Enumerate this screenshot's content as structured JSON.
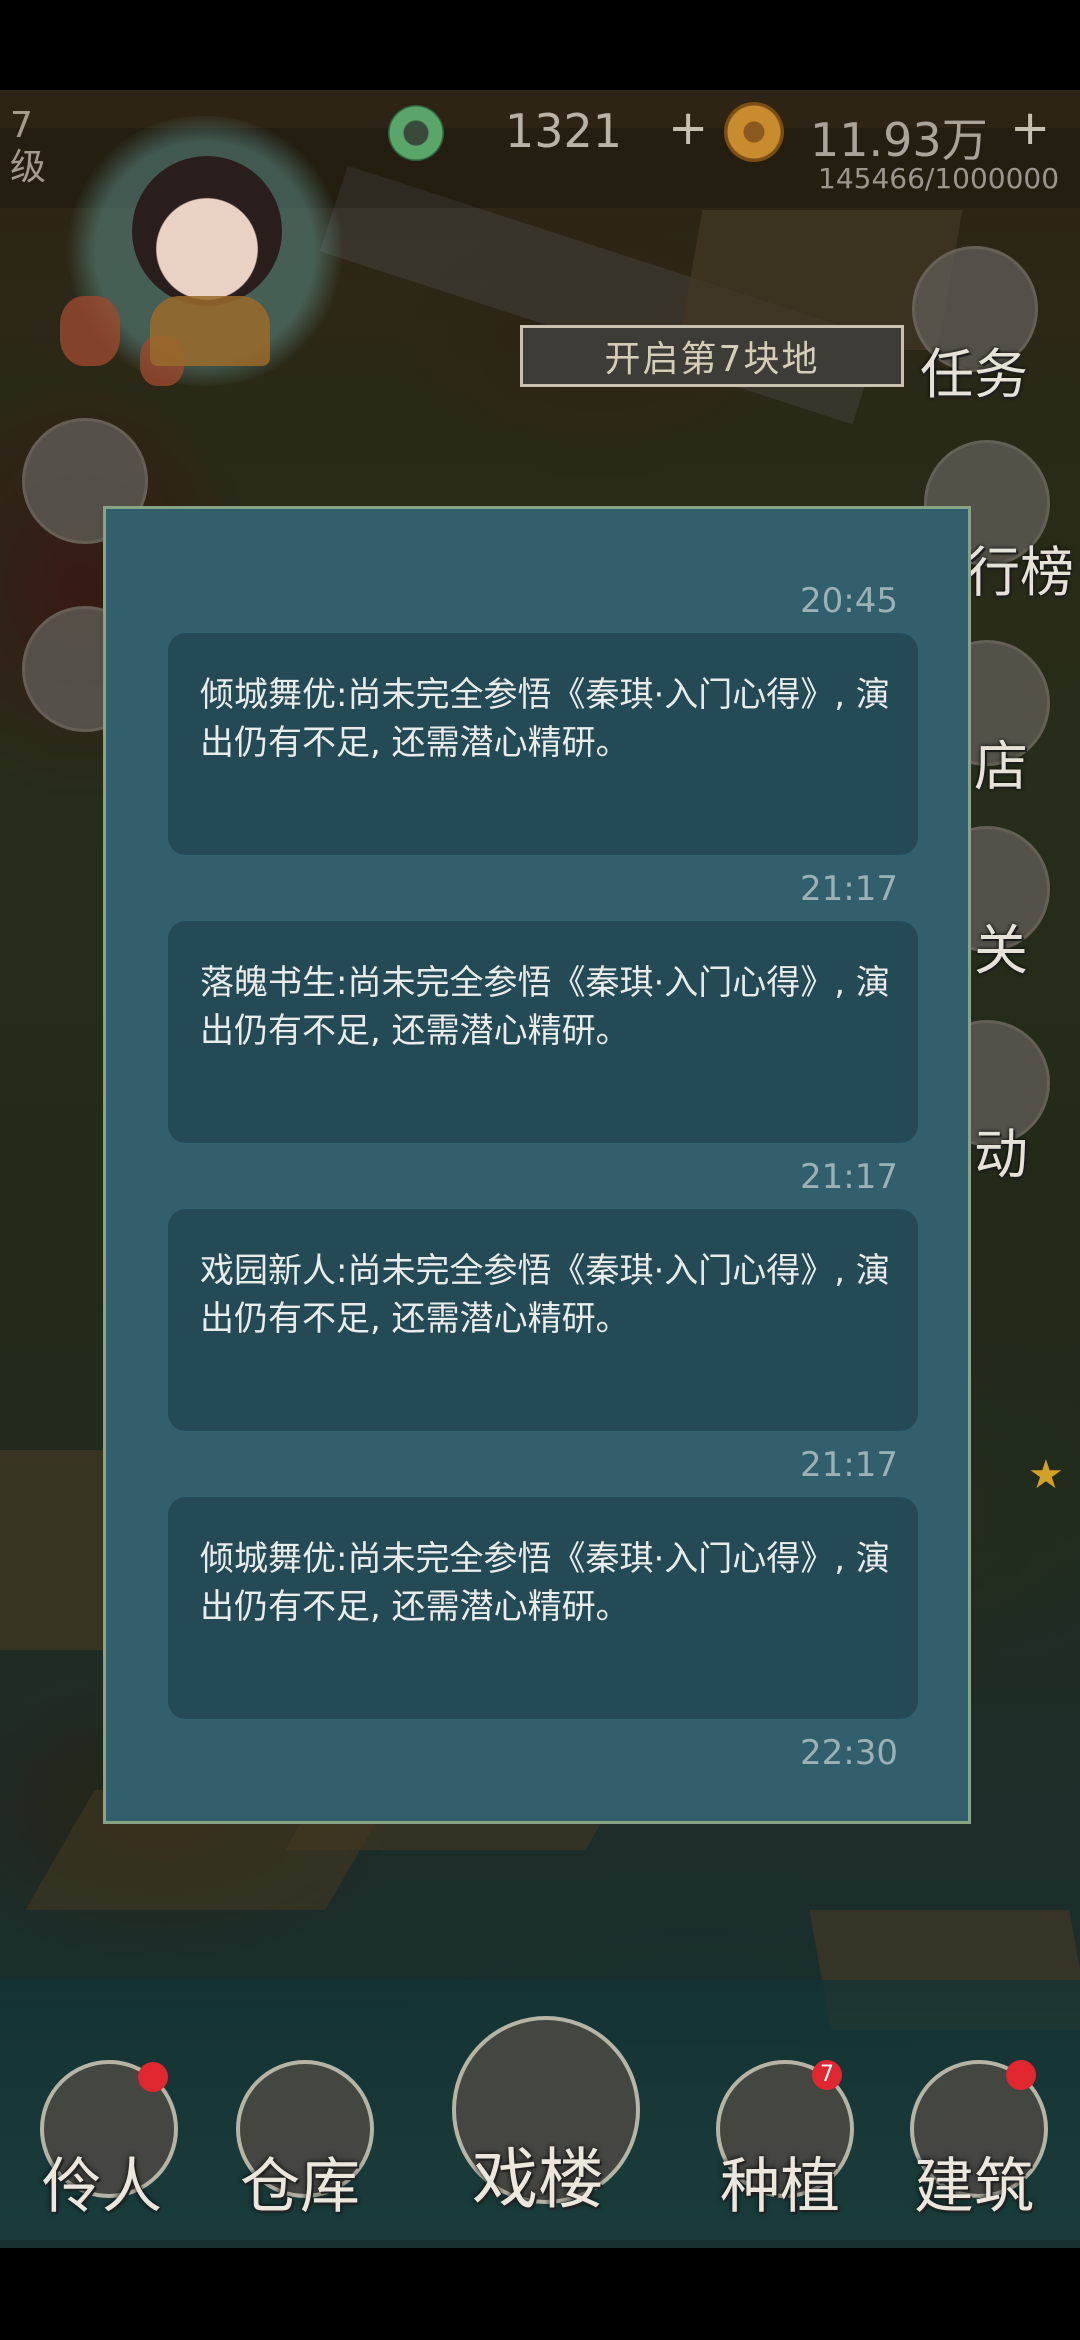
{
  "hud": {
    "level_num": "7",
    "level_unit": "级",
    "jade_value": "1321",
    "coin_value": "11.93万",
    "plus": "+",
    "exp_text": "145466/1000000"
  },
  "banner": {
    "open_land": "开启第7块地"
  },
  "side_menu": {
    "task": "任务",
    "ranking": "行榜",
    "shop": "店",
    "level": "关",
    "event": "动"
  },
  "bottom_menu": {
    "actors": "伶人",
    "warehouse": "仓库",
    "theater": "戏楼",
    "planting": "种植",
    "planting_badge": "7",
    "building": "建筑"
  },
  "messages": [
    {
      "time": "20:45",
      "text": "倾城舞优:尚未完全参悟《秦琪·入门心得》, 演出仍有不足, 还需潜心精研。"
    },
    {
      "time": "21:17",
      "text": "落魄书生:尚未完全参悟《秦琪·入门心得》, 演出仍有不足, 还需潜心精研。"
    },
    {
      "time": "21:17",
      "text": "戏园新人:尚未完全参悟《秦琪·入门心得》, 演出仍有不足, 还需潜心精研。"
    },
    {
      "time": "21:17",
      "text": "倾城舞优:尚未完全参悟《秦琪·入门心得》, 演出仍有不足, 还需潜心精研。"
    }
  ],
  "last_time": "22:30",
  "icons": {
    "jade": "jade-icon",
    "coin": "coin-icon",
    "star": "star-icon"
  },
  "colors": {
    "panel_bg": "#325f6c",
    "panel_border": "#88a384",
    "message_bg": "#244a55",
    "badge_red": "#e0262e"
  }
}
